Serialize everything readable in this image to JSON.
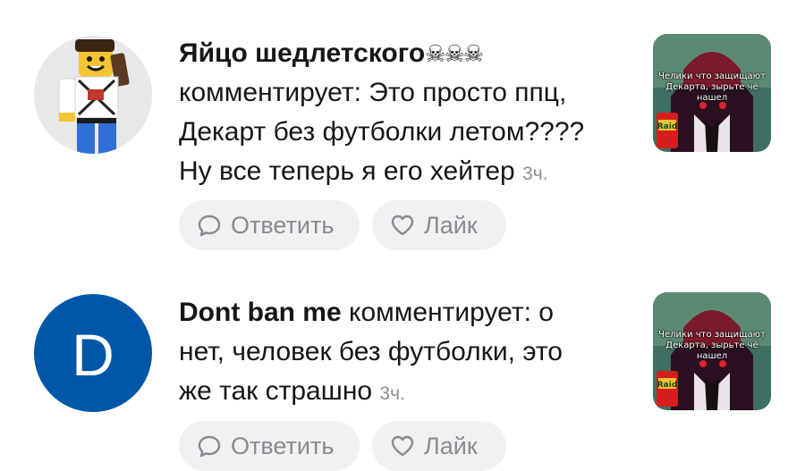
{
  "comments": [
    {
      "author": "Яйцо шедлетского",
      "author_suffix": "☠☠☠",
      "text_lines": [
        "комментирует: Это просто ппц,",
        "Декарт без футболки летом????",
        "Ну все теперь я его хейтер"
      ],
      "time": "3ч.",
      "reply_label": "Ответить",
      "like_label": "Лайк",
      "thumbnail_caption": "Челики что защищают Декарта, зырьте чё нашел",
      "thumbnail_logo": "Raid"
    },
    {
      "author": "Dont ban me",
      "avatar_letter": "D",
      "text_lines": [
        " комментирует: о",
        "нет, человек без футболки, это",
        "же так страшно"
      ],
      "time": "3ч.",
      "reply_label": "Ответить",
      "like_label": "Лайк",
      "thumbnail_caption": "Челики что защищают Декарта, зырьте чё нашел",
      "thumbnail_logo": "Raid"
    }
  ],
  "colors": {
    "avatar_blue": "#0057a8",
    "pill_bg": "#f1f1f3",
    "muted_text": "#8a8a8e"
  }
}
